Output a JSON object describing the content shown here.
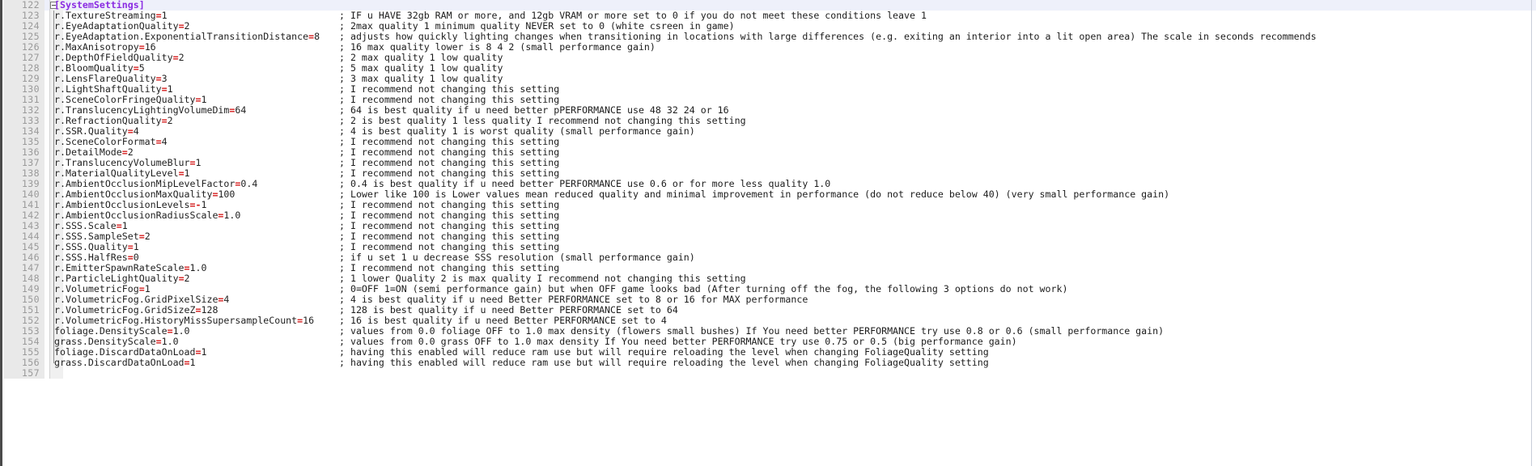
{
  "editor": {
    "app": "text-editor",
    "file_type": "ini-config",
    "active_line": 122,
    "first_visible_line": 122,
    "last_visible_line": 157,
    "colors": {
      "background": "#ffffff",
      "gutter_background": "#e9e9e9",
      "gutter_text": "#9a9a9a",
      "active_line_highlight": "#eef0fa",
      "section_header": "#8a2be2",
      "operator": "#d41919",
      "default_text": "#1f1f1f",
      "comment": "#1c1c1c",
      "fold_margin": "#f0f0f0",
      "edge_bar": "#4a4a4a",
      "right_guide": "#c8cdd8"
    },
    "fold_marker": {
      "line": 122,
      "state": "expanded",
      "glyph": "minus-box"
    }
  },
  "lines": [
    {
      "number": "122",
      "kind": "section",
      "section": "[SystemSettings]",
      "comment": "",
      "fold": "header",
      "active": true
    },
    {
      "number": "123",
      "kind": "setting",
      "key": "r.TextureStreaming",
      "eq": "=",
      "value": "1",
      "comment": "; IF u HAVE 32gb RAM or more, and 12gb VRAM or more set to 0 if you do not meet these conditions leave 1"
    },
    {
      "number": "124",
      "kind": "setting",
      "key": "r.EyeAdaptationQuality",
      "eq": "=",
      "value": "2",
      "comment": "; 2max quality 1 minimum quality NEVER set to 0 (white csreen in game)"
    },
    {
      "number": "125",
      "kind": "setting",
      "key": "r.EyeAdaptation.ExponentialTransitionDistance",
      "eq": "=",
      "value": "8",
      "comment": "; adjusts how quickly lighting changes when transitioning in locations with large differences (e.g. exiting an interior into a lit open area) The scale in seconds recommends"
    },
    {
      "number": "126",
      "kind": "setting",
      "key": "r.MaxAnisotropy",
      "eq": "=",
      "value": "16",
      "comment": "; 16 max quality lower is 8 4 2 (small performance gain)"
    },
    {
      "number": "127",
      "kind": "setting",
      "key": "r.DepthOfFieldQuality",
      "eq": "=",
      "value": "2",
      "comment": "; 2 max quality 1 low quality"
    },
    {
      "number": "128",
      "kind": "setting",
      "key": "r.BloomQuality",
      "eq": "=",
      "value": "5",
      "comment": "; 5 max quality 1 low quality"
    },
    {
      "number": "129",
      "kind": "setting",
      "key": "r.LensFlareQuality",
      "eq": "=",
      "value": "3",
      "comment": "; 3 max quality 1 low quality"
    },
    {
      "number": "130",
      "kind": "setting",
      "key": "r.LightShaftQuality",
      "eq": "=",
      "value": "1",
      "comment": "; I recommend not changing this setting"
    },
    {
      "number": "131",
      "kind": "setting",
      "key": "r.SceneColorFringeQuality",
      "eq": "=",
      "value": "1",
      "comment": "; I recommend not changing this setting"
    },
    {
      "number": "132",
      "kind": "setting",
      "key": "r.TranslucencyLightingVolumeDim",
      "eq": "=",
      "value": "64",
      "comment": "; 64 is best quality if u need better pPERFORMANCE use 48 32 24 or 16"
    },
    {
      "number": "133",
      "kind": "setting",
      "key": "r.RefractionQuality",
      "eq": "=",
      "value": "2",
      "comment": "; 2 is best quality 1 less quality I recommend not changing this setting"
    },
    {
      "number": "134",
      "kind": "setting",
      "key": "r.SSR.Quality",
      "eq": "=",
      "value": "4",
      "comment": "; 4 is best quality 1 is worst quality (small performance gain)"
    },
    {
      "number": "135",
      "kind": "setting",
      "key": "r.SceneColorFormat",
      "eq": "=",
      "value": "4",
      "comment": "; I recommend not changing this setting"
    },
    {
      "number": "136",
      "kind": "setting",
      "key": "r.DetailMode",
      "eq": "=",
      "value": "2",
      "comment": "; I recommend not changing this setting"
    },
    {
      "number": "137",
      "kind": "setting",
      "key": "r.TranslucencyVolumeBlur",
      "eq": "=",
      "value": "1",
      "comment": "; I recommend not changing this setting"
    },
    {
      "number": "138",
      "kind": "setting",
      "key": "r.MaterialQualityLevel",
      "eq": "=",
      "value": "1",
      "comment": "; I recommend not changing this setting"
    },
    {
      "number": "139",
      "kind": "setting",
      "key": "r.AmbientOcclusionMipLevelFactor",
      "eq": "=",
      "value": "0.4",
      "comment": "; 0.4 is best quality if u need better PERFORMANCE use 0.6 or for more less quality 1.0"
    },
    {
      "number": "140",
      "kind": "setting",
      "key": "r.AmbientOcclusionMaxQuality",
      "eq": "=",
      "value": "100",
      "comment": "; Lower like 100 is Lower values mean reduced quality and minimal improvement in performance (do not reduce below 40) (very small performance gain)"
    },
    {
      "number": "141",
      "kind": "setting",
      "key": "r.AmbientOcclusionLevels",
      "eq": "=-",
      "value": "1",
      "comment": "; I recommend not changing this setting"
    },
    {
      "number": "142",
      "kind": "setting",
      "key": "r.AmbientOcclusionRadiusScale",
      "eq": "=",
      "value": "1.0",
      "comment": "; I recommend not changing this setting"
    },
    {
      "number": "143",
      "kind": "setting",
      "key": "r.SSS.Scale",
      "eq": "=",
      "value": "1",
      "comment": "; I recommend not changing this setting"
    },
    {
      "number": "144",
      "kind": "setting",
      "key": "r.SSS.SampleSet",
      "eq": "=",
      "value": "2",
      "comment": "; I recommend not changing this setting"
    },
    {
      "number": "145",
      "kind": "setting",
      "key": "r.SSS.Quality",
      "eq": "=",
      "value": "1",
      "comment": "; I recommend not changing this setting"
    },
    {
      "number": "146",
      "kind": "setting",
      "key": "r.SSS.HalfRes",
      "eq": "=",
      "value": "0",
      "comment": "; if u set 1 u decrease SSS resolution (small performance gain)"
    },
    {
      "number": "147",
      "kind": "setting",
      "key": "r.EmitterSpawnRateScale",
      "eq": "=",
      "value": "1.0",
      "comment": "; I recommend not changing this setting"
    },
    {
      "number": "148",
      "kind": "setting",
      "key": "r.ParticleLightQuality",
      "eq": "=",
      "value": "2",
      "comment": "; 1 lower Quality 2 is max quality I recommend not changing this setting"
    },
    {
      "number": "149",
      "kind": "setting",
      "key": "r.VolumetricFog",
      "eq": "=",
      "value": "1",
      "comment": "; 0=OFF 1=ON (semi performance gain) but when OFF game looks bad (After turning off the fog, the following 3 options do not work)"
    },
    {
      "number": "150",
      "kind": "setting",
      "key": "r.VolumetricFog.GridPixelSize",
      "eq": "=",
      "value": "4",
      "comment": "; 4 is best quality if u need Better PERFORMANCE set to 8 or 16 for MAX performance"
    },
    {
      "number": "151",
      "kind": "setting",
      "key": "r.VolumetricFog.GridSizeZ",
      "eq": "=",
      "value": "128",
      "comment": "; 128 is best quality if u need Better PERFORMANCE set to 64"
    },
    {
      "number": "152",
      "kind": "setting",
      "key": "r.VolumetricFog.HistoryMissSupersampleCount",
      "eq": "=",
      "value": "16",
      "comment": "; 16 is best quality if u need Better PERFORMANCE set to 4"
    },
    {
      "number": "153",
      "kind": "setting",
      "key": "foliage.DensityScale",
      "eq": "=",
      "value": "1.0",
      "comment": "; values from 0.0 foliage OFF to 1.0 max density (flowers small bushes) If You need better PERFORMANCE try use 0.8 or 0.6 (small performance gain)"
    },
    {
      "number": "154",
      "kind": "setting",
      "key": "grass.DensityScale",
      "eq": "=",
      "value": "1.0",
      "comment": "; values from 0.0 grass OFF to 1.0 max density If You need better PERFORMANCE try use 0.75 or 0.5 (big performance gain)"
    },
    {
      "number": "155",
      "kind": "setting",
      "key": "foliage.DiscardDataOnLoad",
      "eq": "=",
      "value": "1",
      "comment": "; having this enabled will reduce ram use but will require reloading the level when changing FoliageQuality setting"
    },
    {
      "number": "156",
      "kind": "setting",
      "key": "grass.DiscardDataOnLoad",
      "eq": "=",
      "value": "1",
      "comment": "; having this enabled will reduce ram use but will require reloading the level when changing FoliageQuality setting"
    },
    {
      "number": "157",
      "kind": "empty",
      "key": "",
      "eq": "",
      "value": "",
      "comment": ""
    }
  ]
}
